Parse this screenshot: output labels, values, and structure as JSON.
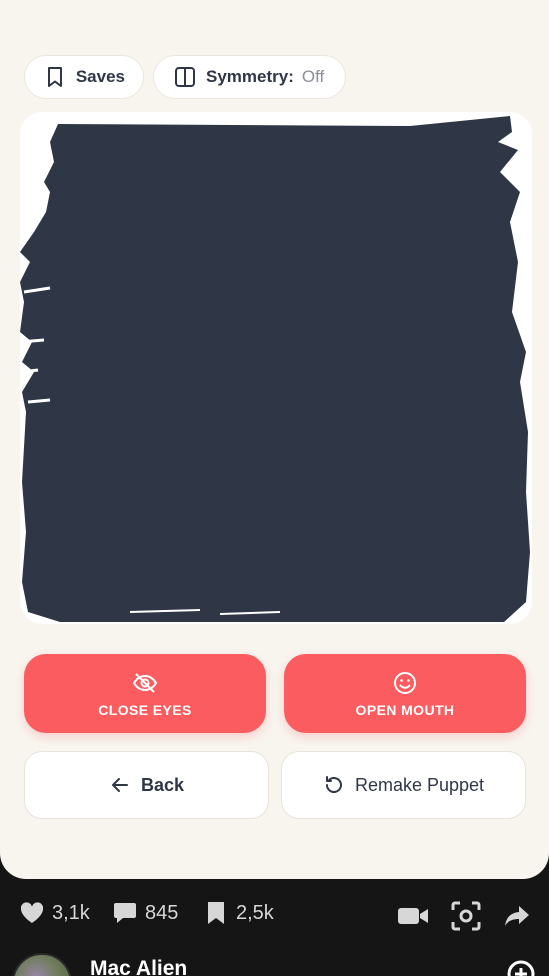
{
  "toolbar": {
    "saves_label": "Saves",
    "symmetry_label": "Symmetry:",
    "symmetry_value": "Off"
  },
  "canvas": {
    "fill_color": "#2f3747",
    "background_color": "#ffffff"
  },
  "actions": {
    "close_eyes_label": "CLOSE EYES",
    "open_mouth_label": "OPEN MOUTH",
    "accent_color": "#fa5c5f"
  },
  "navigation": {
    "back_label": "Back",
    "remake_label": "Remake Puppet"
  },
  "feed": {
    "likes": "3,1k",
    "comments": "845",
    "bookmarks": "2,5k",
    "username": "Mac Alien"
  },
  "icons": {
    "saves": "bookmark-outline-icon",
    "symmetry": "split-square-icon",
    "close_eyes": "eye-off-icon",
    "open_mouth": "smile-icon",
    "back": "arrow-left-icon",
    "remake": "refresh-icon",
    "likes": "heart-icon",
    "comments": "chat-bubble-icon",
    "bookmarks": "bookmark-icon",
    "video": "video-camera-icon",
    "scan": "camera-scan-icon",
    "share": "share-arrow-icon",
    "add": "add-icon"
  }
}
